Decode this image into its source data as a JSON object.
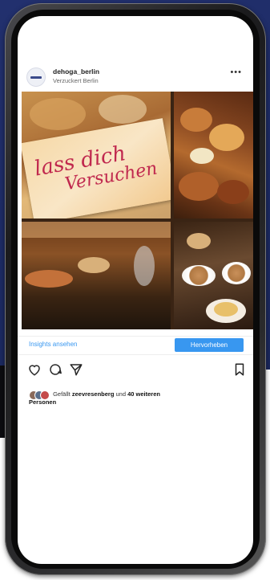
{
  "post": {
    "username": "dehoga_berlin",
    "location": "Verzuckert Berlin",
    "more_label": "•••",
    "image": {
      "card_text_line1": "lass dich",
      "card_text_line2": "Versuchen"
    }
  },
  "insights": {
    "link_label": "Insights ansehen",
    "promote_label": "Hervorheben"
  },
  "likes": {
    "prefix": "Gefällt",
    "user": "zeevresenberg",
    "middle": "und",
    "others": "40 weiteren",
    "suffix": "Personen"
  },
  "colors": {
    "background": "#1f2c66",
    "accent": "#3897f0",
    "card_text": "#c0284e"
  },
  "icons": [
    "heart-icon",
    "comment-icon",
    "share-icon",
    "bookmark-icon",
    "more-icon"
  ]
}
